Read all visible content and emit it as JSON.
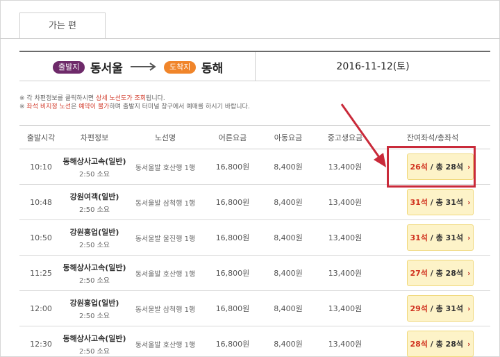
{
  "tab": {
    "label": "가는 편"
  },
  "route": {
    "departure_label": "출발지",
    "departure_city": "동서울",
    "arrival_label": "도착지",
    "arrival_city": "동해",
    "date": "2016-11-12(토)"
  },
  "notes": {
    "line1_prefix": "※ 각 차편정보를 클릭하시면 ",
    "line1_link": "상세 노선도가 조회",
    "line1_suffix": "됩니다.",
    "line2_prefix": "※ ",
    "line2_red1": "좌석 비지정 노선",
    "line2_mid": "은 ",
    "line2_red2": "예약이 불가",
    "line2_suffix": "하며 출발지 터미널 창구에서 예매를 하시기 바랍니다."
  },
  "table": {
    "headers": [
      "출발시각",
      "차편정보",
      "노선명",
      "어른요금",
      "아동요금",
      "중고생요금",
      "잔여좌석/총좌석"
    ],
    "rows": [
      {
        "time": "10:10",
        "company": "동해상사고속(일반)",
        "duration": "2:50 소요",
        "route": "동서울발 호산행 1행",
        "adult": "16,800원",
        "child": "8,400원",
        "student": "13,400원",
        "remaining": "26석",
        "total": "/ 총 28석"
      },
      {
        "time": "10:48",
        "company": "강원여객(일반)",
        "duration": "2:50 소요",
        "route": "동서울발 삼척행 1행",
        "adult": "16,800원",
        "child": "8,400원",
        "student": "13,400원",
        "remaining": "31석",
        "total": "/ 총 31석"
      },
      {
        "time": "10:50",
        "company": "강원흥업(일반)",
        "duration": "2:50 소요",
        "route": "동서울발 울진행 1행",
        "adult": "16,800원",
        "child": "8,400원",
        "student": "13,400원",
        "remaining": "31석",
        "total": "/ 총 31석"
      },
      {
        "time": "11:25",
        "company": "동해상사고속(일반)",
        "duration": "2:50 소요",
        "route": "동서울발 호산행 1행",
        "adult": "16,800원",
        "child": "8,400원",
        "student": "13,400원",
        "remaining": "27석",
        "total": "/ 총 28석"
      },
      {
        "time": "12:00",
        "company": "강원흥업(일반)",
        "duration": "2:50 소요",
        "route": "동서울발 삼척행 1행",
        "adult": "16,800원",
        "child": "8,400원",
        "student": "13,400원",
        "remaining": "29석",
        "total": "/ 총 31석"
      },
      {
        "time": "12:30",
        "company": "동해상사고속(일반)",
        "duration": "2:50 소요",
        "route": "동서울발 호산행 1행",
        "adult": "16,800원",
        "child": "8,400원",
        "student": "13,400원",
        "remaining": "28석",
        "total": "/ 총 28석"
      }
    ]
  },
  "colors": {
    "departure_pill": "#6e2a6a",
    "arrival_pill": "#f0852a",
    "seat_button_bg": "#fdf3c8",
    "remaining_text": "#d0321f",
    "highlight": "#c92a3a"
  },
  "icons": {
    "route_arrow": "arrow-right-icon",
    "seat_chevron": "chevron-right-icon"
  }
}
